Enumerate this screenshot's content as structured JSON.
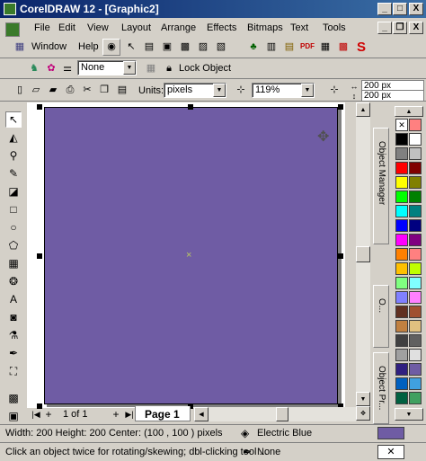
{
  "window": {
    "title": "CorelDRAW 12 - [Graphic2]",
    "minimize": "_",
    "maximize": "□",
    "close": "X",
    "doc_minimize": "_",
    "doc_restore": "❐",
    "doc_close": "X"
  },
  "menu": {
    "items": [
      "File",
      "Edit",
      "View",
      "Layout",
      "Arrange",
      "Effects",
      "Bitmaps",
      "Text",
      "Tools",
      "Window",
      "Help"
    ]
  },
  "toolbar": {
    "outline_combo": "None",
    "lock_object": "Lock Object"
  },
  "property_bar": {
    "units_label": "Units:",
    "units_value": "pixels",
    "zoom_value": "119%",
    "width_value": "200 px",
    "height_value": "200 px"
  },
  "page_nav": {
    "counter": "1 of 1",
    "page_tab": "Page 1"
  },
  "dockers": {
    "object_manager": "Object Manager",
    "object_props": "O...",
    "object_props2": "Object Pr..."
  },
  "status": {
    "dimensions": "Width: 200  Height: 200  Center: (100 , 100 )  pixels",
    "fill_name": "Electric Blue",
    "hint": "Click an object twice for rotating/skewing; dbl-clicking tool ...",
    "outline_name": "None"
  },
  "colors": {
    "shape_fill": "#6f5ca4",
    "palette": [
      "#000000",
      "#ffffff",
      "#808080",
      "#c0c0c0",
      "#ff0000",
      "#800000",
      "#ffff00",
      "#808000",
      "#00ff00",
      "#008000",
      "#00ffff",
      "#008080",
      "#0000ff",
      "#000080",
      "#ff00ff",
      "#800080",
      "#ff8000",
      "#ff8080",
      "#ffc000",
      "#c0ff00",
      "#80ff80",
      "#80ffff",
      "#8080ff",
      "#ff80ff"
    ]
  }
}
